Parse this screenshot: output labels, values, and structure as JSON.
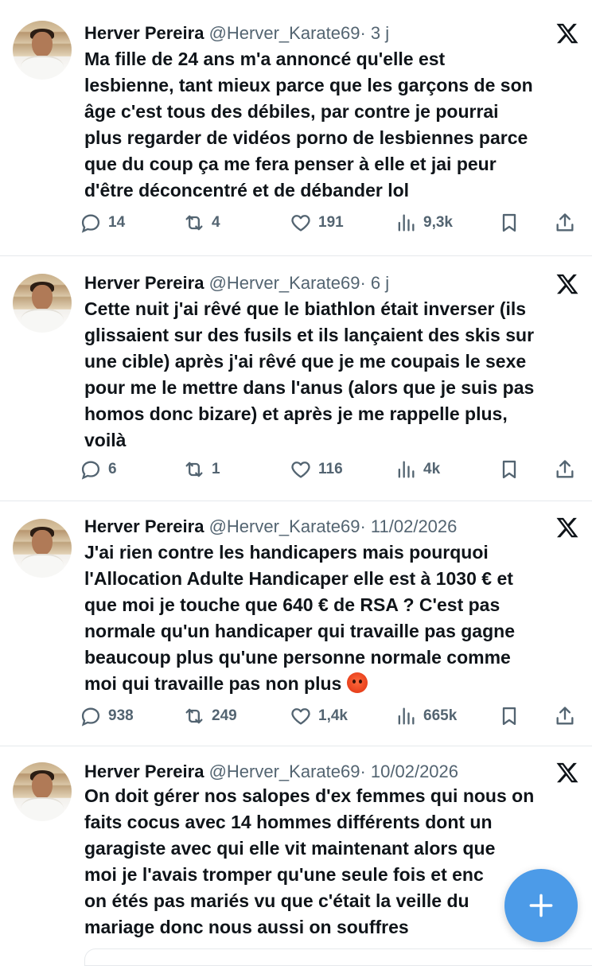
{
  "tweets": [
    {
      "name": "Herver Pereira",
      "handle": "@Herver_Karate69",
      "dot": "·",
      "date": "3 j",
      "text": "Ma fille de 24 ans m'a annoncé qu'elle est\nlesbienne, tant mieux parce que les garçons de son\nâge c'est tous des débiles, par contre je pourrai\nplus regarder de vidéos porno de lesbiennes parce\nque du coup ça me fera penser à elle et jai peur\nd'être déconcentré et de débander lol",
      "emoji": "",
      "replies": "14",
      "reposts": "4",
      "likes": "191",
      "views": "9,3k"
    },
    {
      "name": "Herver Pereira",
      "handle": "@Herver_Karate69",
      "dot": "·",
      "date": "6 j",
      "text": "Cette nuit j'ai rêvé que le biathlon était inverser (ils\nglissaient sur des fusils et ils lançaient des skis sur\nune cible) après j'ai rêvé que je me coupais le sexe\npour me le mettre dans l'anus (alors que je suis pas\nhomos donc bizare) et après je me rappelle plus,\nvoilà",
      "emoji": "",
      "replies": "6",
      "reposts": "1",
      "likes": "116",
      "views": "4k"
    },
    {
      "name": "Herver Pereira",
      "handle": "@Herver_Karate69",
      "dot": "·",
      "date": "11/02/2026",
      "text": "J'ai rien contre les handicapers mais pourquoi\nl'Allocation Adulte Handicaper elle est à 1030 € et\nque moi je touche que 640 € de RSA ? C'est pas\nnormale qu'un handicaper qui travaille pas gagne\nbeaucoup plus  qu'une personne normale comme\nmoi qui travaille pas non plus ",
      "emoji": "angry-face",
      "replies": "938",
      "reposts": "249",
      "likes": "1,4k",
      "views": "665k"
    },
    {
      "name": "Herver Pereira",
      "handle": "@Herver_Karate69",
      "dot": "·",
      "date": "10/02/2026",
      "text": "On doit gérer nos salopes d'ex femmes qui nous on\nfaits cocus avec 14 hommes différents dont un\ngaragiste avec qui elle vit maintenant alors que\nmoi je l'avais tromper qu'une seule fois et enc\non étés pas mariés vu que c'était la veille du\nmariage donc nous aussi on souffres",
      "emoji": ""
    }
  ],
  "colors": {
    "accent": "#4c9be8",
    "muted": "#536471",
    "text": "#0f1419"
  }
}
